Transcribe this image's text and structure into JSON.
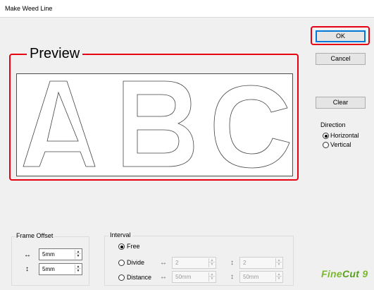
{
  "window": {
    "title": "Make Weed Line"
  },
  "buttons": {
    "ok": "OK",
    "cancel": "Cancel",
    "clear": "Clear"
  },
  "preview": {
    "label": "Preview",
    "text_shown": "ABC"
  },
  "direction": {
    "label": "Direction",
    "options": [
      "Horizontal",
      "Vertical"
    ],
    "selected": "Horizontal"
  },
  "frame_offset": {
    "label": "Frame Offset",
    "horizontal": "5mm",
    "vertical": "5mm"
  },
  "interval": {
    "label": "Interval",
    "modes": [
      "Free",
      "Divide",
      "Distance"
    ],
    "selected": "Free",
    "divide": {
      "horizontal": "2",
      "vertical": "2"
    },
    "distance": {
      "horizontal": "50mm",
      "vertical": "50mm"
    }
  },
  "symbols": {
    "horizontal_arrow": "↔",
    "vertical_arrow": "↕"
  },
  "icons": {
    "spin_up": "up-arrow-icon",
    "spin_down": "down-arrow-icon"
  },
  "brand": {
    "logo": "FineCut9"
  },
  "colors": {
    "highlight": "#e60012",
    "logo": "#7cb82f",
    "default_button": "#0078d7"
  }
}
